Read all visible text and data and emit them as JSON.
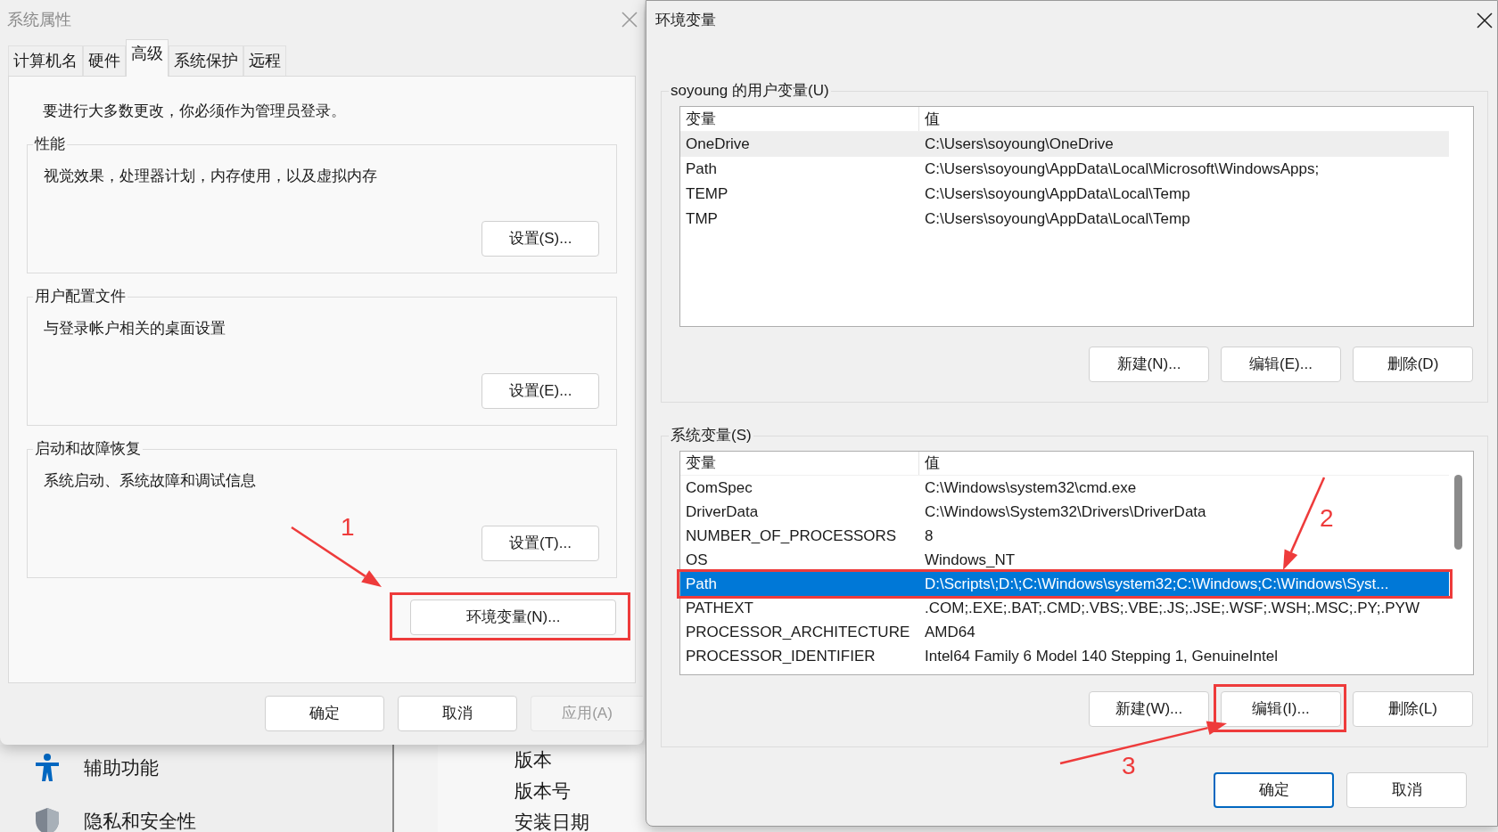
{
  "background_app": {
    "sidebar_items": [
      {
        "label": "辅助功能",
        "kind": "accessibility"
      },
      {
        "label": "隐私和安全性",
        "kind": "privacy"
      }
    ],
    "info_labels": [
      "版本",
      "版本号",
      "安装日期"
    ]
  },
  "system_properties": {
    "title": "系统属性",
    "tabs": [
      {
        "label": "计算机名",
        "selected": false
      },
      {
        "label": "硬件",
        "selected": false
      },
      {
        "label": "高级",
        "selected": true
      },
      {
        "label": "系统保护",
        "selected": false
      },
      {
        "label": "远程",
        "selected": false
      }
    ],
    "notice": "要进行大多数更改，你必须作为管理员登录。",
    "groups": [
      {
        "title": "性能",
        "description": "视觉效果，处理器计划，内存使用，以及虚拟内存",
        "button": "设置(S)..."
      },
      {
        "title": "用户配置文件",
        "description": "与登录帐户相关的桌面设置",
        "button": "设置(E)..."
      },
      {
        "title": "启动和故障恢复",
        "description": "系统启动、系统故障和调试信息",
        "button": "设置(T)..."
      }
    ],
    "env_button": "环境变量(N)...",
    "buttons": [
      {
        "label": "确定",
        "disabled": false
      },
      {
        "label": "取消",
        "disabled": false
      },
      {
        "label": "应用(A)",
        "disabled": true
      }
    ]
  },
  "environment_variables": {
    "title": "环境变量",
    "user_vars": {
      "title": "soyoung 的用户变量(U)",
      "focused": false,
      "columns": [
        "变量",
        "值"
      ],
      "rows": [
        {
          "name": "OneDrive",
          "value": "C:\\Users\\soyoung\\OneDrive",
          "selected": true
        },
        {
          "name": "Path",
          "value": "C:\\Users\\soyoung\\AppData\\Local\\Microsoft\\WindowsApps;",
          "selected": false
        },
        {
          "name": "TEMP",
          "value": "C:\\Users\\soyoung\\AppData\\Local\\Temp",
          "selected": false
        },
        {
          "name": "TMP",
          "value": "C:\\Users\\soyoung\\AppData\\Local\\Temp",
          "selected": false
        }
      ],
      "buttons": [
        "新建(N)...",
        "编辑(E)...",
        "删除(D)"
      ]
    },
    "system_vars": {
      "title": "系统变量(S)",
      "focused": true,
      "columns": [
        "变量",
        "值"
      ],
      "rows": [
        {
          "name": "ComSpec",
          "value": "C:\\Windows\\system32\\cmd.exe",
          "selected": false
        },
        {
          "name": "DriverData",
          "value": "C:\\Windows\\System32\\Drivers\\DriverData",
          "selected": false
        },
        {
          "name": "NUMBER_OF_PROCESSORS",
          "value": "8",
          "selected": false
        },
        {
          "name": "OS",
          "value": "Windows_NT",
          "selected": false
        },
        {
          "name": "Path",
          "value": "D:\\Scripts\\;D:\\;C:\\Windows\\system32;C:\\Windows;C:\\Windows\\Syst...",
          "selected": true
        },
        {
          "name": "PATHEXT",
          "value": ".COM;.EXE;.BAT;.CMD;.VBS;.VBE;.JS;.JSE;.WSF;.WSH;.MSC;.PY;.PYW",
          "selected": false
        },
        {
          "name": "PROCESSOR_ARCHITECTURE",
          "value": "AMD64",
          "selected": false
        },
        {
          "name": "PROCESSOR_IDENTIFIER",
          "value": "Intel64 Family 6 Model 140 Stepping 1, GenuineIntel",
          "selected": false
        }
      ],
      "buttons": [
        "新建(W)...",
        "编辑(I)...",
        "删除(L)"
      ]
    },
    "buttons": [
      {
        "label": "确定",
        "default": true
      },
      {
        "label": "取消",
        "default": false
      }
    ]
  },
  "annotations": [
    {
      "label": "1"
    },
    {
      "label": "2"
    },
    {
      "label": "3"
    }
  ]
}
